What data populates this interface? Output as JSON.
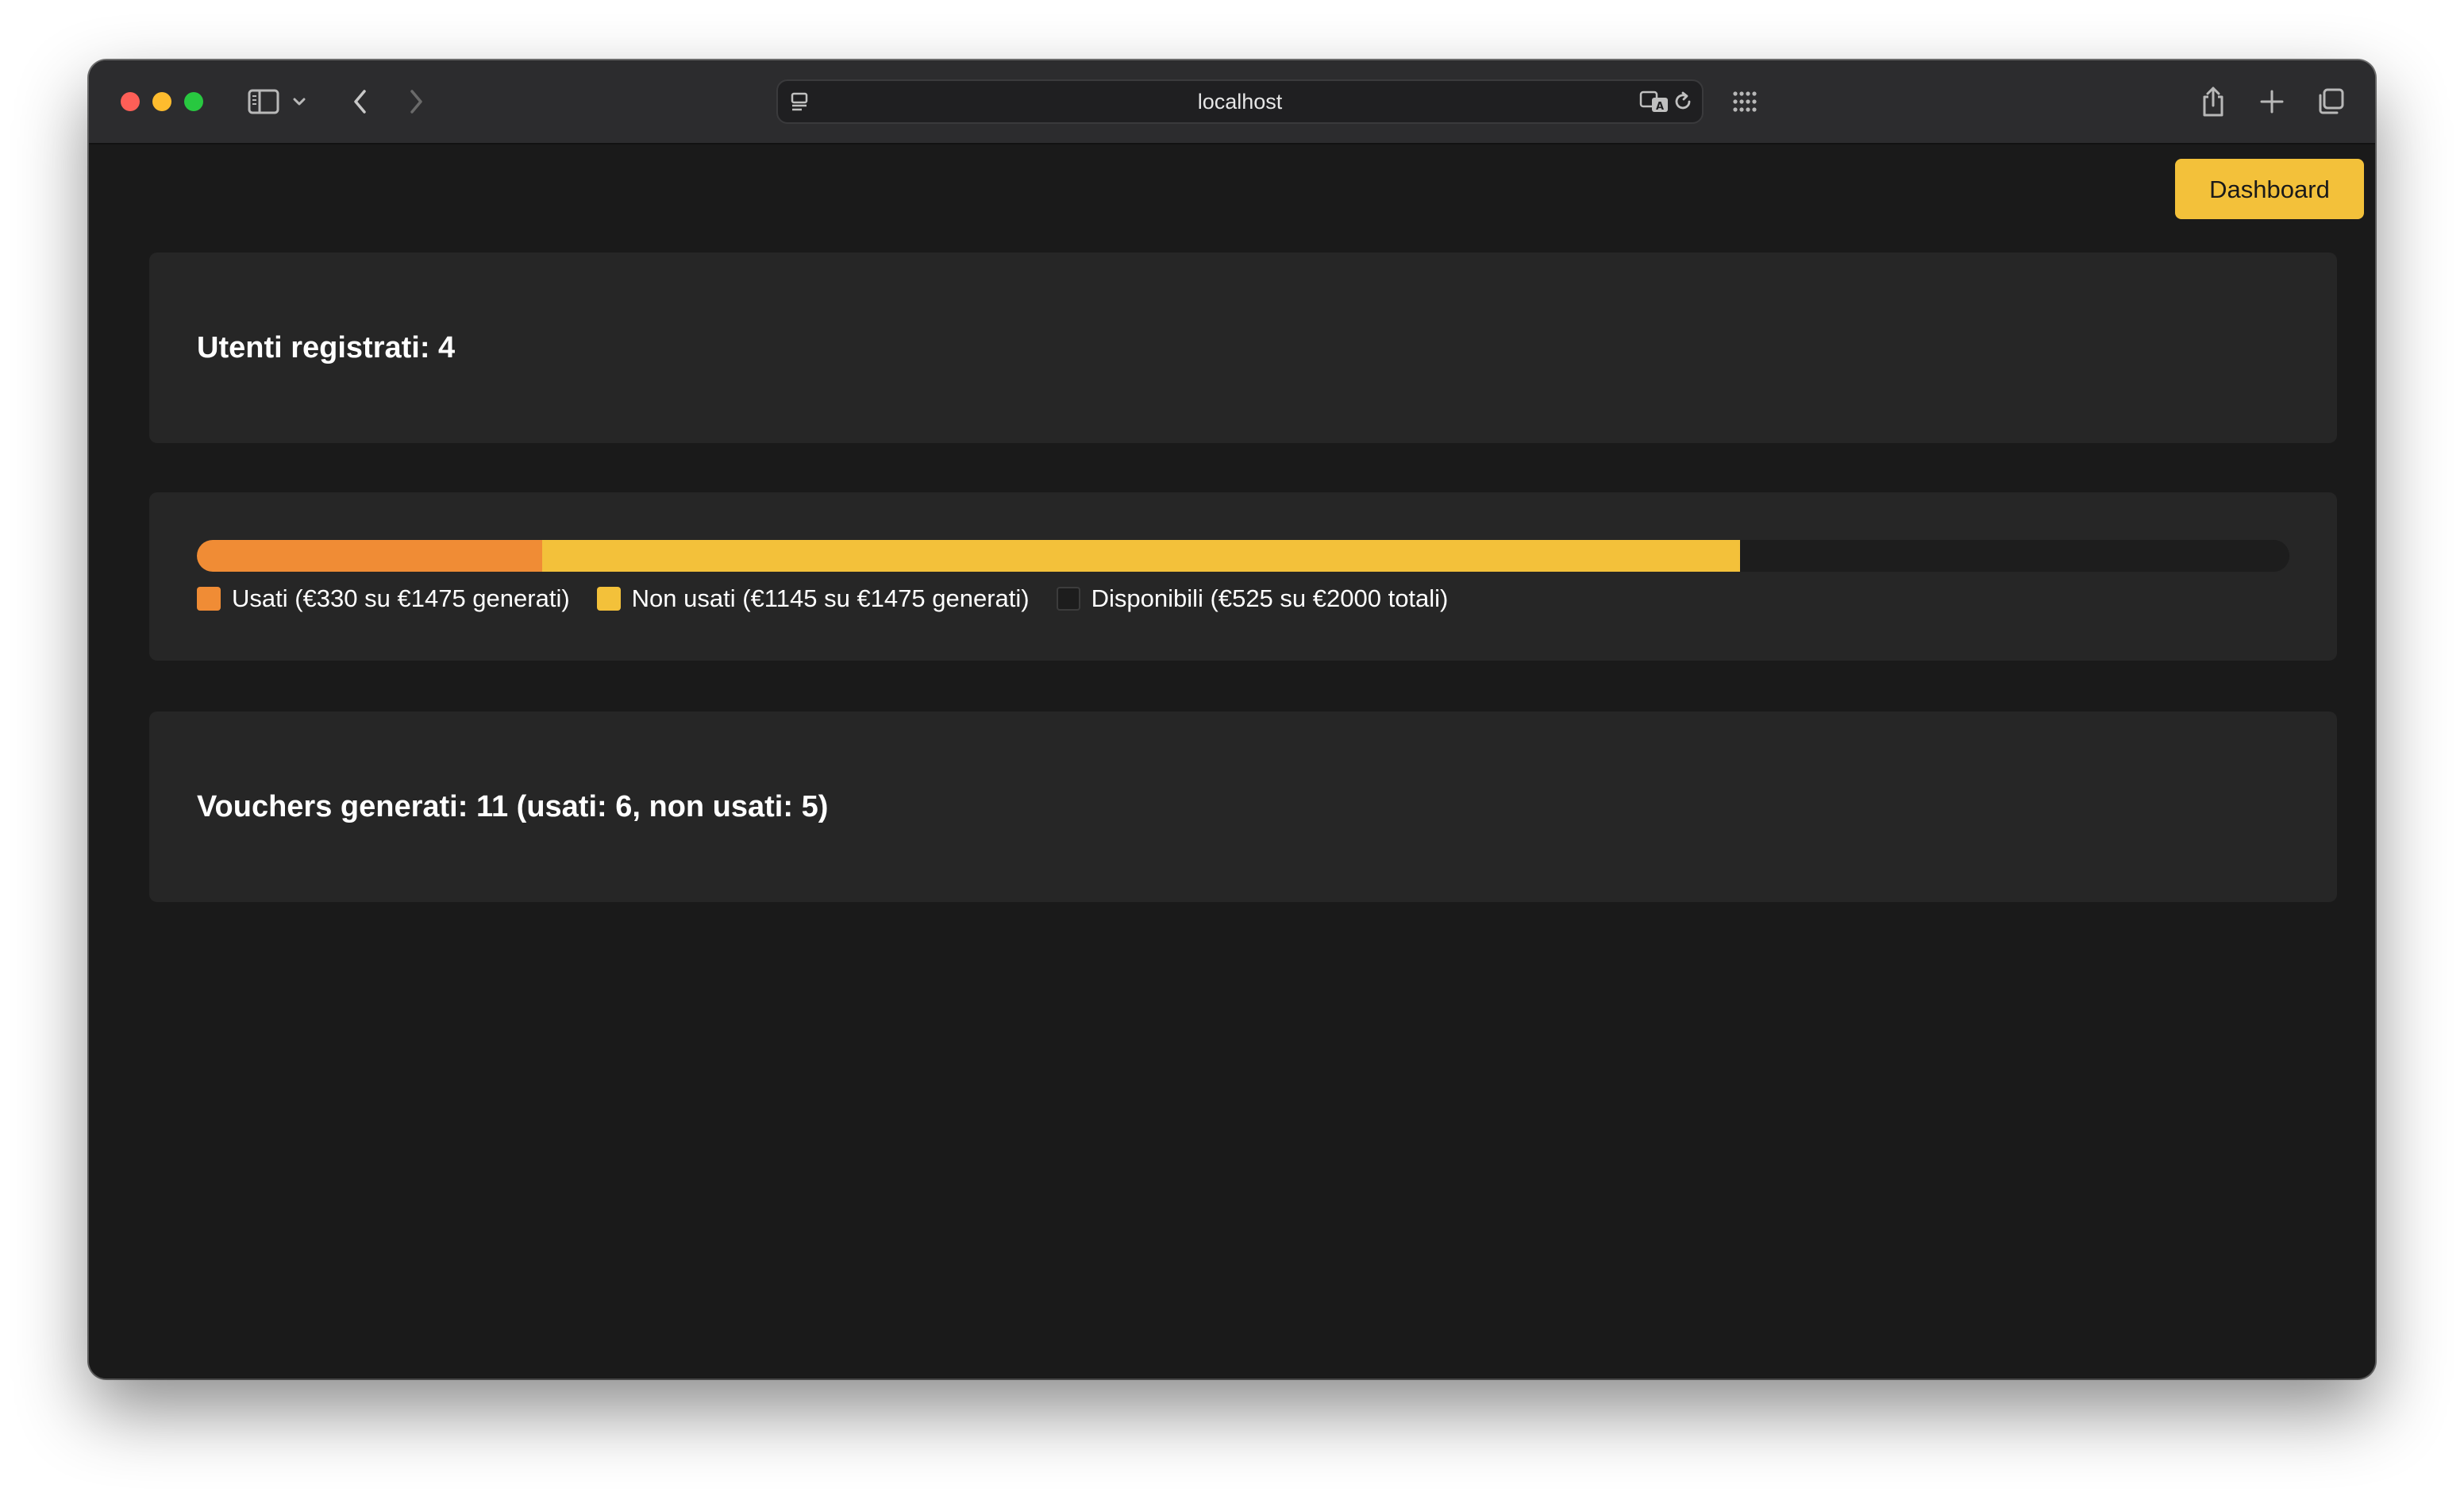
{
  "browser": {
    "url": "localhost"
  },
  "header": {
    "dashboard_label": "Dashboard"
  },
  "stats": {
    "users_text": "Utenti registrati: 4",
    "vouchers_text": "Vouchers generati: 11 (usati: 6, non usati: 5)"
  },
  "budget": {
    "total": 2000,
    "used": 330,
    "unused": 1145,
    "available": 525,
    "colors": {
      "used": "#f08c35",
      "unused": "#f3c13a",
      "available": "#1d1d1d"
    },
    "legend": {
      "used": "Usati (€330 su €1475 generati)",
      "unused": "Non usati (€1145 su €1475 generati)",
      "available": "Disponibili (€525 su €2000 totali)"
    }
  }
}
